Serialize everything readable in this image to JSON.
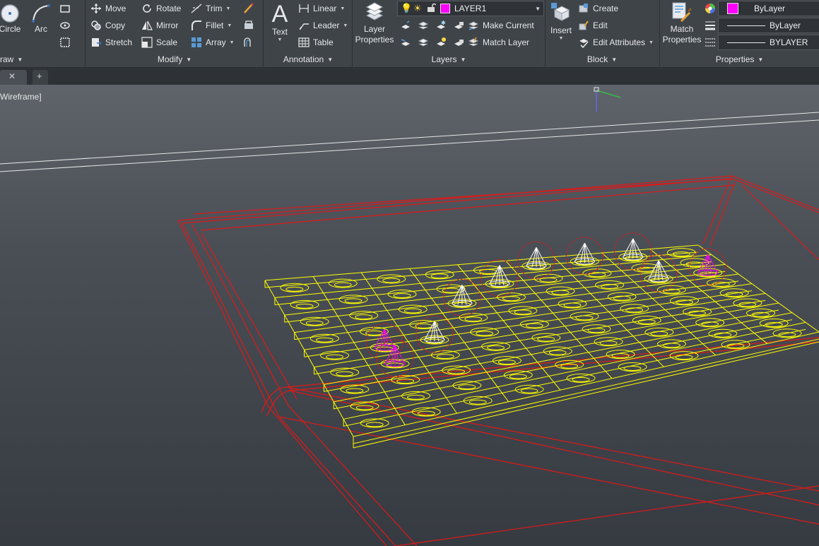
{
  "ribbon": {
    "draw": {
      "title": "raw",
      "circle": "Circle",
      "arc": "Arc"
    },
    "modify": {
      "title": "Modify",
      "move": "Move",
      "rotate": "Rotate",
      "trim": "Trim",
      "copy": "Copy",
      "mirror": "Mirror",
      "fillet": "Fillet",
      "stretch": "Stretch",
      "scale": "Scale",
      "array": "Array"
    },
    "annotation": {
      "title": "Annotation",
      "text": "Text",
      "linear": "Linear",
      "leader": "Leader",
      "table": "Table"
    },
    "layers": {
      "title": "Layers",
      "layer_properties_line1": "Layer",
      "layer_properties_line2": "Properties",
      "current_layer": "LAYER1",
      "layer_color": "#ff00ff",
      "make_current": "Make Current",
      "match_layer": "Match Layer"
    },
    "block": {
      "title": "Block",
      "insert": "Insert",
      "create": "Create",
      "edit": "Edit",
      "edit_attributes": "Edit Attributes"
    },
    "properties": {
      "title": "Properties",
      "match_line1": "Match",
      "match_line2": "Properties",
      "color": "ByLayer",
      "color_swatch": "#ff00ff",
      "linetype": "ByLayer",
      "lineweight": "BYLAYER"
    }
  },
  "viewport": {
    "label": "Wireframe]"
  },
  "colors": {
    "ribbon_bg": "#3f4449",
    "viewport_top": "#5f646b",
    "viewport_bottom": "#363a41",
    "frame_red": "#e01818",
    "tray_yellow": "#ffff00",
    "cone_white": "#ffffff",
    "cone_magenta": "#ff00ff"
  }
}
